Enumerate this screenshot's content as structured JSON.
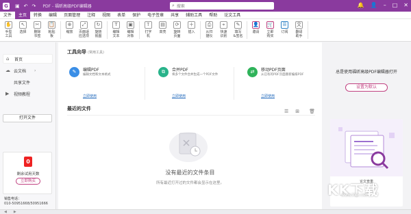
{
  "titlebar": {
    "title": "PDF - 福昕高级PDF编辑器",
    "search_placeholder": "搜索"
  },
  "menu": {
    "items": [
      "文件",
      "主页",
      "转换",
      "编辑",
      "页面管理",
      "注释",
      "视图",
      "表单",
      "保护",
      "电子签章",
      "共享",
      "辅助工具",
      "帮助",
      "论文工具"
    ],
    "active_index": 1
  },
  "ribbon": [
    {
      "label": "手型\n工具",
      "icon": "✋"
    },
    {
      "label": "选择",
      "icon": "↖"
    },
    {
      "label": "删除\n书签",
      "icon": "✂"
    },
    {
      "label": "粘贴\n板",
      "icon": "📋"
    },
    {
      "label": "缩放",
      "icon": "⊕"
    },
    {
      "label": "页面适\n应选项",
      "icon": "⤢"
    },
    {
      "label": "旋转\n视图",
      "icon": "↻"
    },
    {
      "label": "编辑\n文本",
      "icon": "T"
    },
    {
      "label": "编辑\n对象",
      "icon": "▣"
    },
    {
      "label": "打字\n机",
      "icon": "Ꭲ"
    },
    {
      "label": "高亮",
      "icon": "▤"
    },
    {
      "label": "旋转\n页面",
      "icon": "⟳"
    },
    {
      "label": "插入",
      "icon": "＋"
    },
    {
      "label": "从扫\n描仪",
      "icon": "⎙"
    },
    {
      "label": "快速\n识别",
      "icon": "⌖"
    },
    {
      "label": "填写\n&签名",
      "icon": "✎"
    },
    {
      "label": "邀请",
      "icon": "👤"
    },
    {
      "label": "立即\n购买",
      "icon": "🛒"
    },
    {
      "label": "订阅",
      "icon": "☰"
    },
    {
      "label": "翻译\n助手",
      "icon": "文"
    }
  ],
  "sidebar": {
    "items": [
      {
        "label": "首页",
        "icon": "⌂"
      },
      {
        "label": "云文档",
        "icon": "☁"
      },
      {
        "label": "共享文件",
        "icon": ""
      },
      {
        "label": "视频教程",
        "icon": "▶"
      }
    ],
    "open_file": "打开文件",
    "trial_days": "0",
    "trial_label": "剩余试用天数",
    "buy_now": "立即购买",
    "sales_title": "销售电话：",
    "sales_phone": "010-50951668/50951666"
  },
  "tool_guide": {
    "title": "工具向导",
    "subtitle": "(常用工具)",
    "tools": [
      {
        "name": "编辑PDF",
        "desc": "编辑文档和文本格式",
        "link": "立即使用",
        "color": "#3a8ee6",
        "icon": "✎"
      },
      {
        "name": "合并PDF",
        "desc": "将多个文件合并生成一个PDF文件",
        "link": "立即使用",
        "color": "#28b38a",
        "icon": "⧉"
      },
      {
        "name": "移动PDF页面",
        "desc": "从已有的PDF页面重新编排PDF",
        "link": "立即使用",
        "color": "#2fb35a",
        "icon": "⇄"
      }
    ]
  },
  "recent": {
    "title": "最近的文件",
    "empty_title": "没有最近的文件条目",
    "empty_desc": "所有最近打开过的文件都会显示在这里。"
  },
  "promo": {
    "title": "总是使用福昕高级PDF编辑器打开",
    "button": "设置为默认",
    "ad_label": "论文查重"
  },
  "watermark": {
    "main": "KK下载",
    "sub": "www.kkx.net"
  }
}
